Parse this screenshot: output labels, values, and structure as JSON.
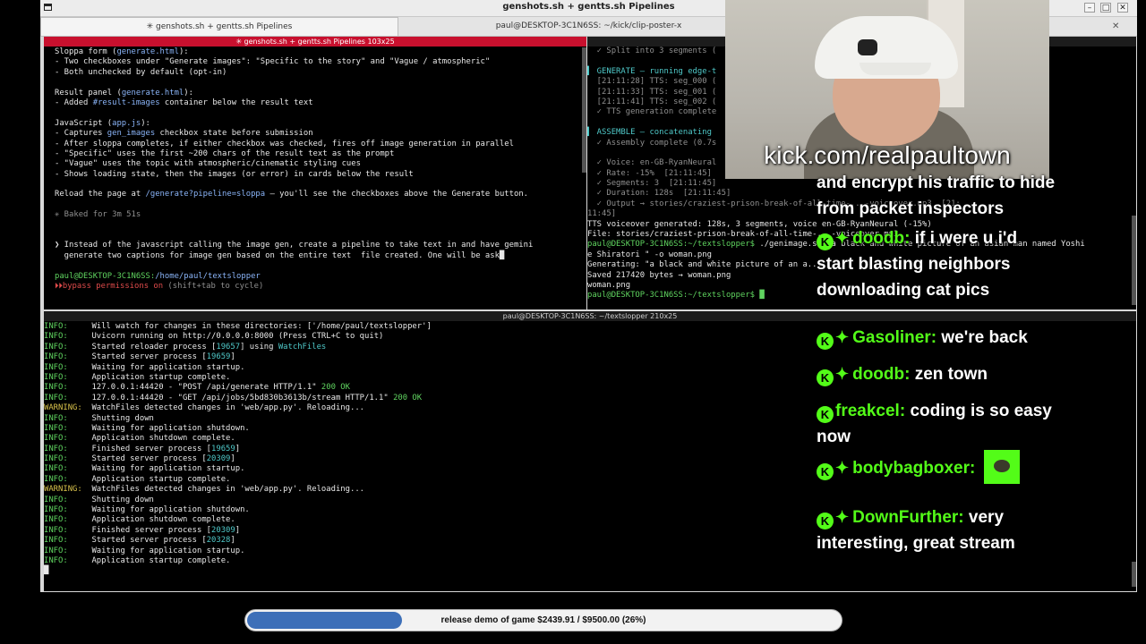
{
  "window": {
    "title": "genshots.sh + gentts.sh Pipelines",
    "tabs": [
      {
        "label": "✳ genshots.sh + gentts.sh Pipelines",
        "active": true
      },
      {
        "label": "paul@DESKTOP-3C1N6SS: ~/kick/clip-poster-x",
        "active": false
      }
    ],
    "buttons": [
      "–",
      "□",
      "✕"
    ]
  },
  "pane_top_left": {
    "header": "✳ genshots.sh + gentts.sh Pipelines 103x25",
    "lines": [
      [
        [
          "Sloppa form (",
          "w"
        ],
        [
          "generate.html",
          "b"
        ],
        [
          "):",
          "w"
        ]
      ],
      [
        [
          "- Two checkboxes under \"Generate images\": \"Specific to the story\" and \"Vague / atmospheric\"",
          "w"
        ]
      ],
      [
        [
          "- Both unchecked by default (opt-in)",
          "w"
        ]
      ],
      [
        [
          "",
          "w"
        ]
      ],
      [
        [
          "Result panel (",
          "w"
        ],
        [
          "generate.html",
          "b"
        ],
        [
          "):",
          "w"
        ]
      ],
      [
        [
          "- Added ",
          "w"
        ],
        [
          "#result-images",
          "b"
        ],
        [
          " container below the result text",
          "w"
        ]
      ],
      [
        [
          "",
          "w"
        ]
      ],
      [
        [
          "JavaScript (",
          "w"
        ],
        [
          "app.js",
          "b"
        ],
        [
          "):",
          "w"
        ]
      ],
      [
        [
          "- Captures ",
          "w"
        ],
        [
          "gen_images",
          "b"
        ],
        [
          " checkbox state before submission",
          "w"
        ]
      ],
      [
        [
          "- After sloppa completes, if either checkbox was checked, fires off image generation in parallel",
          "w"
        ]
      ],
      [
        [
          "- \"Specific\" uses the first ~200 chars of the result text as the prompt",
          "w"
        ]
      ],
      [
        [
          "- \"Vague\" uses the topic with atmospheric/cinematic styling cues",
          "w"
        ]
      ],
      [
        [
          "- Shows loading state, then the images (or error) in cards below the result",
          "w"
        ]
      ],
      [
        [
          "",
          "w"
        ]
      ],
      [
        [
          "Reload the page at ",
          "w"
        ],
        [
          "/generate?pipeline=sloppa",
          "b"
        ],
        [
          " — you'll see the checkboxes above the Generate button.",
          "w"
        ]
      ],
      [
        [
          "",
          "w"
        ]
      ],
      [
        [
          "✳ Baked for 3m 51s",
          "gr"
        ]
      ],
      [
        [
          "",
          "w"
        ]
      ],
      [
        [
          "",
          "w"
        ]
      ],
      [
        [
          "❯ Instead of the javascript calling the image gen, create a pipeline to take text in and have gemini",
          "w"
        ]
      ],
      [
        [
          "  generate two captions for image gen based on the entire text  file created. One will be ask█",
          "w"
        ]
      ],
      [
        [
          "",
          "w"
        ]
      ],
      [
        [
          "paul@DESKTOP-3C1N6SS:",
          "g"
        ],
        [
          "/home/paul/textslopper",
          "b"
        ]
      ],
      [
        [
          "⏵⏵",
          "r"
        ],
        [
          "bypass permissions on",
          "r"
        ],
        [
          " (shift+tab to cycle)",
          "gr"
        ]
      ]
    ]
  },
  "pane_top_right": {
    "header": "",
    "lines": [
      [
        [
          "  ✓ Split into 3 segments (",
          "gr"
        ]
      ],
      [
        [
          "",
          "w"
        ]
      ],
      [
        [
          "▍ GENERATE — running edge-t",
          "c"
        ]
      ],
      [
        [
          "  [21:11:28] TTS: seg_000 (",
          "gr"
        ]
      ],
      [
        [
          "  [21:11:33] TTS: seg_001 (",
          "gr"
        ]
      ],
      [
        [
          "  [21:11:41] TTS: seg_002 (",
          "gr"
        ]
      ],
      [
        [
          "  ✓ TTS generation complete",
          "gr"
        ]
      ],
      [
        [
          "",
          "w"
        ]
      ],
      [
        [
          "▍ ASSEMBLE — concatenating",
          "c"
        ]
      ],
      [
        [
          "  ✓ Assembly complete (0.7s",
          "gr"
        ]
      ],
      [
        [
          "",
          "w"
        ]
      ],
      [
        [
          "  ✓ Voice: en-GB-RyanNeural",
          "gr"
        ]
      ],
      [
        [
          "  ✓ Rate: -15%  [21:11:45]",
          "gr"
        ]
      ],
      [
        [
          "  ✓ Segments: 3  [21:11:45]",
          "gr"
        ]
      ],
      [
        [
          "  ✓ Duration: 128s  [21:11:45]",
          "gr"
        ]
      ],
      [
        [
          "  ✓ Output → stories/craziest-prison-break-of-all-time-...-voiceover.mp3  [21:",
          "gr"
        ]
      ],
      [
        [
          "11:45]",
          "gr"
        ]
      ],
      [
        [
          "TTS voiceover generated: 128s, 3 segments, voice en-GB-RyanNeural (-15%)",
          "w"
        ]
      ],
      [
        [
          "File: stories/craziest-prison-break-of-all-time-...-voiceover.mp3",
          "w"
        ]
      ],
      [
        [
          "paul@DESKTOP-3C1N6SS:~/textslopper$ ",
          "g"
        ],
        [
          "./genimage.sh \"a black and white picture of an asian man named Yoshi",
          "w"
        ]
      ],
      [
        [
          "e Shiratori \" -o woman.png",
          "w"
        ]
      ],
      [
        [
          "Generating: \"a black and white picture of an a...",
          "w"
        ]
      ],
      [
        [
          "Saved 217420 bytes → woman.png",
          "w"
        ]
      ],
      [
        [
          "woman.png",
          "w"
        ]
      ],
      [
        [
          "paul@DESKTOP-3C1N6SS:~/textslopper$ █",
          "g"
        ]
      ]
    ]
  },
  "pane_bottom": {
    "header": "paul@DESKTOP-3C1N6SS: ~/textslopper 210x25",
    "lines": [
      [
        [
          "INFO:     ",
          "g"
        ],
        [
          "Will watch for changes in these directories: ['/home/paul/textslopper']",
          "w"
        ]
      ],
      [
        [
          "INFO:     ",
          "g"
        ],
        [
          "Uvicorn running on ",
          "w"
        ],
        [
          "http://0.0.0.0:8000",
          "w"
        ],
        [
          " (Press CTRL+C to quit)",
          "w"
        ]
      ],
      [
        [
          "INFO:     ",
          "g"
        ],
        [
          "Started reloader process [",
          "w"
        ],
        [
          "19657",
          "c"
        ],
        [
          "] using ",
          "w"
        ],
        [
          "WatchFiles",
          "c"
        ]
      ],
      [
        [
          "INFO:     ",
          "g"
        ],
        [
          "Started server process [",
          "w"
        ],
        [
          "19659",
          "c"
        ],
        [
          "]",
          "w"
        ]
      ],
      [
        [
          "INFO:     ",
          "g"
        ],
        [
          "Waiting for application startup.",
          "w"
        ]
      ],
      [
        [
          "INFO:     ",
          "g"
        ],
        [
          "Application startup complete.",
          "w"
        ]
      ],
      [
        [
          "INFO:     ",
          "g"
        ],
        [
          "127.0.0.1:44420 - \"POST /api/generate HTTP/1.1\" ",
          "w"
        ],
        [
          "200 OK",
          "g"
        ]
      ],
      [
        [
          "INFO:     ",
          "g"
        ],
        [
          "127.0.0.1:44420 - \"GET /api/jobs/5bd830b3613b/stream HTTP/1.1\" ",
          "w"
        ],
        [
          "200 OK",
          "g"
        ]
      ],
      [
        [
          "WARNING:  ",
          "y"
        ],
        [
          "WatchFiles detected changes in 'web/app.py'. Reloading...",
          "w"
        ]
      ],
      [
        [
          "INFO:     ",
          "g"
        ],
        [
          "Shutting down",
          "w"
        ]
      ],
      [
        [
          "INFO:     ",
          "g"
        ],
        [
          "Waiting for application shutdown.",
          "w"
        ]
      ],
      [
        [
          "INFO:     ",
          "g"
        ],
        [
          "Application shutdown complete.",
          "w"
        ]
      ],
      [
        [
          "INFO:     ",
          "g"
        ],
        [
          "Finished server process [",
          "w"
        ],
        [
          "19659",
          "c"
        ],
        [
          "]",
          "w"
        ]
      ],
      [
        [
          "INFO:     ",
          "g"
        ],
        [
          "Started server process [",
          "w"
        ],
        [
          "20309",
          "c"
        ],
        [
          "]",
          "w"
        ]
      ],
      [
        [
          "INFO:     ",
          "g"
        ],
        [
          "Waiting for application startup.",
          "w"
        ]
      ],
      [
        [
          "INFO:     ",
          "g"
        ],
        [
          "Application startup complete.",
          "w"
        ]
      ],
      [
        [
          "WARNING:  ",
          "y"
        ],
        [
          "WatchFiles detected changes in 'web/app.py'. Reloading...",
          "w"
        ]
      ],
      [
        [
          "INFO:     ",
          "g"
        ],
        [
          "Shutting down",
          "w"
        ]
      ],
      [
        [
          "INFO:     ",
          "g"
        ],
        [
          "Waiting for application shutdown.",
          "w"
        ]
      ],
      [
        [
          "INFO:     ",
          "g"
        ],
        [
          "Application shutdown complete.",
          "w"
        ]
      ],
      [
        [
          "INFO:     ",
          "g"
        ],
        [
          "Finished server process [",
          "w"
        ],
        [
          "20309",
          "c"
        ],
        [
          "]",
          "w"
        ]
      ],
      [
        [
          "INFO:     ",
          "g"
        ],
        [
          "Started server process [",
          "w"
        ],
        [
          "20328",
          "c"
        ],
        [
          "]",
          "w"
        ]
      ],
      [
        [
          "INFO:     ",
          "g"
        ],
        [
          "Waiting for application startup.",
          "w"
        ]
      ],
      [
        [
          "INFO:     ",
          "g"
        ],
        [
          "Application startup complete.",
          "w"
        ]
      ],
      [
        [
          "█",
          "w"
        ]
      ]
    ]
  },
  "overlay": {
    "kick_url": "kick.com/realpaultown",
    "chat": [
      {
        "user": "",
        "text": "and encrypt his traffic to hide from packet inspectors",
        "badges": [],
        "emote": false
      },
      {
        "user": "doodb:",
        "text": "if i were u i'd start blasting neighbors downloading cat pics",
        "badges": [
          "kick",
          "gem"
        ],
        "emote": false
      },
      {
        "user": "Gasoliner:",
        "text": "we're back",
        "badges": [
          "kick",
          "gem"
        ],
        "emote": false
      },
      {
        "user": "doodb:",
        "text": "zen town",
        "badges": [
          "kick",
          "gem"
        ],
        "emote": false
      },
      {
        "user": "freakcel:",
        "text": "coding is so easy now",
        "badges": [
          "kick"
        ],
        "emote": false
      },
      {
        "user": "bodybagboxer:",
        "text": "",
        "badges": [
          "kick",
          "gem"
        ],
        "emote": true
      },
      {
        "user": "DownFurther:",
        "text": "very interesting, great stream",
        "badges": [
          "kick",
          "gem"
        ],
        "emote": false
      }
    ],
    "progress": {
      "label": "release demo of game $2439.91 / $9500.00 (26%)",
      "fraction": 0.26
    }
  }
}
